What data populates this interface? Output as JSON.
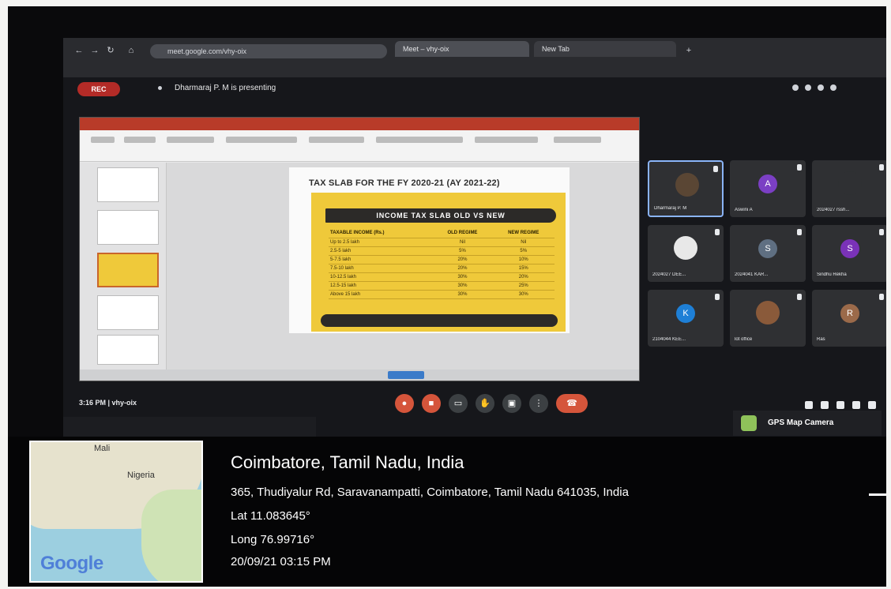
{
  "browser": {
    "url": "meet.google.com/vhy-oix",
    "tabs": [
      "Meet – vhy-oix",
      "New Tab"
    ]
  },
  "meet": {
    "rec_label": "REC",
    "presenting_label": "Dharmaraj P. M is presenting",
    "clock": "3:16 PM | vhy-oix"
  },
  "slide": {
    "title": "TAX SLAB FOR THE FY 2020-21 (AY 2021-22)",
    "card_title": "INCOME TAX SLAB OLD VS NEW",
    "table": {
      "headers": [
        "TAXABLE INCOME (Rs.)",
        "OLD REGIME",
        "NEW REGIME"
      ],
      "rows": [
        [
          "Up to 2.5 lakh",
          "Nil",
          "Nil"
        ],
        [
          "2.5-5 lakh",
          "5%",
          "5%"
        ],
        [
          "5-7.5 lakh",
          "20%",
          "10%"
        ],
        [
          "7.5-10 lakh",
          "20%",
          "15%"
        ],
        [
          "10-12.5 lakh",
          "30%",
          "20%"
        ],
        [
          "12.5-15 lakh",
          "30%",
          "25%"
        ],
        [
          "Above 15 lakh",
          "30%",
          "30%"
        ]
      ]
    }
  },
  "participants": [
    {
      "name": "Dharmaraj P. M",
      "initial": "",
      "color": "#5a4634",
      "speaking": true
    },
    {
      "name": "Aswini A",
      "initial": "A",
      "color": "#7b3fc4"
    },
    {
      "name": "2024027 rssh...",
      "initial": "",
      "color": "#2f3033"
    },
    {
      "name": "2024027 DEE...",
      "initial": "",
      "color": "#e8e8e8"
    },
    {
      "name": "2024041 KAR...",
      "initial": "S",
      "color": "#5f6f82"
    },
    {
      "name": "Sindhu Rekha",
      "initial": "S",
      "color": "#7a32b8"
    },
    {
      "name": "2104044 KEE...",
      "initial": "K",
      "color": "#1e7fd6"
    },
    {
      "name": "lot office",
      "initial": "",
      "color": "#8a5a3a"
    },
    {
      "name": "Ras",
      "initial": "R",
      "color": "#9b6a4a"
    }
  ],
  "gps": {
    "badge": "GPS Map Camera",
    "city": "Coimbatore, Tamil Nadu, India",
    "address": "365, Thudiyalur Rd, Saravanampatti, Coimbatore, Tamil Nadu 641035, India",
    "lat": "Lat 11.083645°",
    "long": "Long 76.99716°",
    "datetime": "20/09/21 03:15 PM",
    "map_labels": {
      "mali": "Mali",
      "nigeria": "Nigeria",
      "google": "Google"
    }
  }
}
